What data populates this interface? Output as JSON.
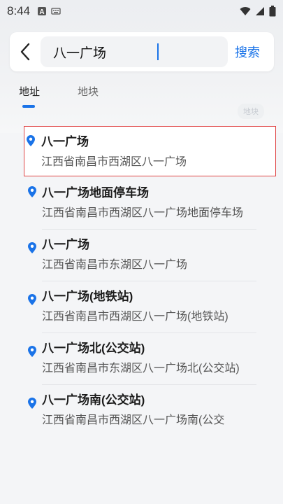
{
  "status_bar": {
    "time": "8:44",
    "icons": [
      "notification-a-icon",
      "keyboard-icon",
      "wifi-icon",
      "cellular-icon",
      "battery-icon"
    ]
  },
  "search": {
    "query": "八一广场",
    "placeholder": "",
    "search_label": "搜索"
  },
  "tabs": [
    {
      "label": "地址",
      "active": true
    },
    {
      "label": "地块",
      "active": false
    }
  ],
  "ghost_label": "地块",
  "colors": {
    "accent": "#1a73e8",
    "selected_border": "#e04545",
    "pin": "#1a73e8"
  },
  "results": [
    {
      "title": "八一广场",
      "address": "江西省南昌市西湖区八一广场",
      "selected": true
    },
    {
      "title": "八一广场地面停车场",
      "address": "江西省南昌市西湖区八一广场地面停车场",
      "selected": false
    },
    {
      "title": "八一广场",
      "address": "江西省南昌市东湖区八一广场",
      "selected": false
    },
    {
      "title": "八一广场(地铁站)",
      "address": "江西省南昌市西湖区八一广场(地铁站)",
      "selected": false
    },
    {
      "title": "八一广场北(公交站)",
      "address": "江西省南昌市东湖区八一广场北(公交站)",
      "selected": false
    },
    {
      "title": "八一广场南(公交站)",
      "address": "江西省南昌市西湖区八一广场南(公交",
      "selected": false
    }
  ]
}
